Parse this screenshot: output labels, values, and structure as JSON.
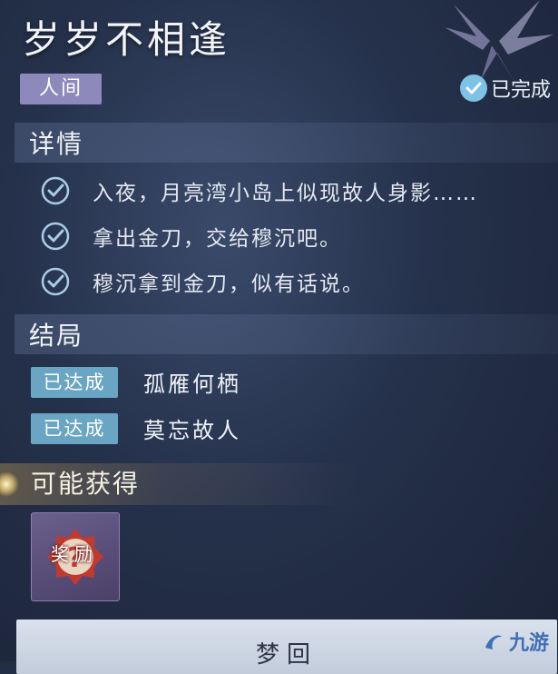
{
  "quest": {
    "title": "岁岁不相逢",
    "tag": "人间",
    "status": "已完成"
  },
  "details": {
    "heading": "详情",
    "items": [
      "入夜，月亮湾小岛上似现故人身影……",
      "拿出金刀，交给穆沉吧。",
      "穆沉拿到金刀，似有话说。"
    ]
  },
  "endings": {
    "heading": "结局",
    "items": [
      {
        "badge": "已达成",
        "name": "孤雁何栖"
      },
      {
        "badge": "已达成",
        "name": "莫忘故人"
      }
    ]
  },
  "rewards": {
    "heading": "可能获得",
    "items": [
      {
        "label": "奖励",
        "icon": "reward-medal-icon"
      }
    ]
  },
  "action_button": "梦回",
  "watermark": "九游",
  "colors": {
    "tag_bg": "#8e89bb",
    "check_accent": "#7ec2e6",
    "badge_bg": "#6aa6c3",
    "button_bg": "#d9e1ec"
  }
}
